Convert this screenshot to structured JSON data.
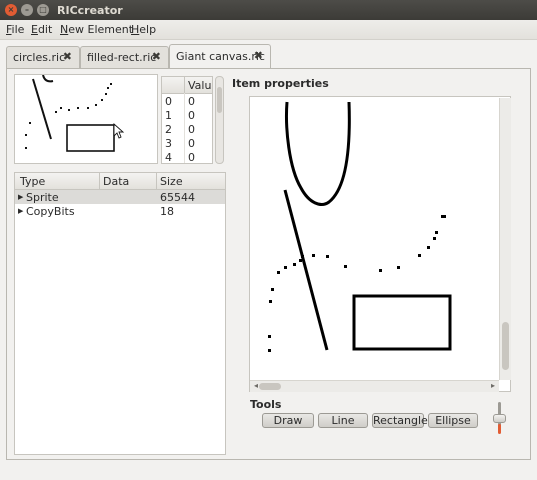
{
  "window": {
    "title": "RICcreator"
  },
  "menu": [
    {
      "m": "F",
      "rest": "ile"
    },
    {
      "m": "E",
      "rest": "dit"
    },
    {
      "m": "N",
      "rest": "ew Element"
    },
    {
      "m": "H",
      "rest": "elp"
    }
  ],
  "tabs": [
    {
      "label": "circles.ric",
      "active": false
    },
    {
      "label": "filled-rect.ric",
      "active": false
    },
    {
      "label": "Giant canvas.ric",
      "active": true
    }
  ],
  "value_table": {
    "header": "Value",
    "rows": [
      {
        "index": "0",
        "value": "0"
      },
      {
        "index": "1",
        "value": "0"
      },
      {
        "index": "2",
        "value": "0"
      },
      {
        "index": "3",
        "value": "0"
      },
      {
        "index": "4",
        "value": "0"
      }
    ]
  },
  "element_tree": {
    "columns": {
      "type": "Type",
      "data": "Data",
      "size": "Size"
    },
    "rows": [
      {
        "type": "Sprite",
        "data": "",
        "size": "65544",
        "selected": true
      },
      {
        "type": "CopyBits",
        "data": "",
        "size": "18",
        "selected": false
      }
    ]
  },
  "properties": {
    "label": "Item properties"
  },
  "tools": {
    "label": "Tools",
    "buttons": [
      "Draw",
      "Line",
      "Rectangle",
      "Ellipse"
    ]
  },
  "icons": {
    "window_close": "close-icon",
    "window_minimize": "minimize-icon",
    "window_maximize": "maximize-icon",
    "tab_close": "x-icon",
    "tree_expander": "triangle-right-icon",
    "cursor": "mouse-pointer-icon"
  },
  "colors": {
    "close_button": "#e25c33",
    "titlebar": "#3c3b37"
  }
}
